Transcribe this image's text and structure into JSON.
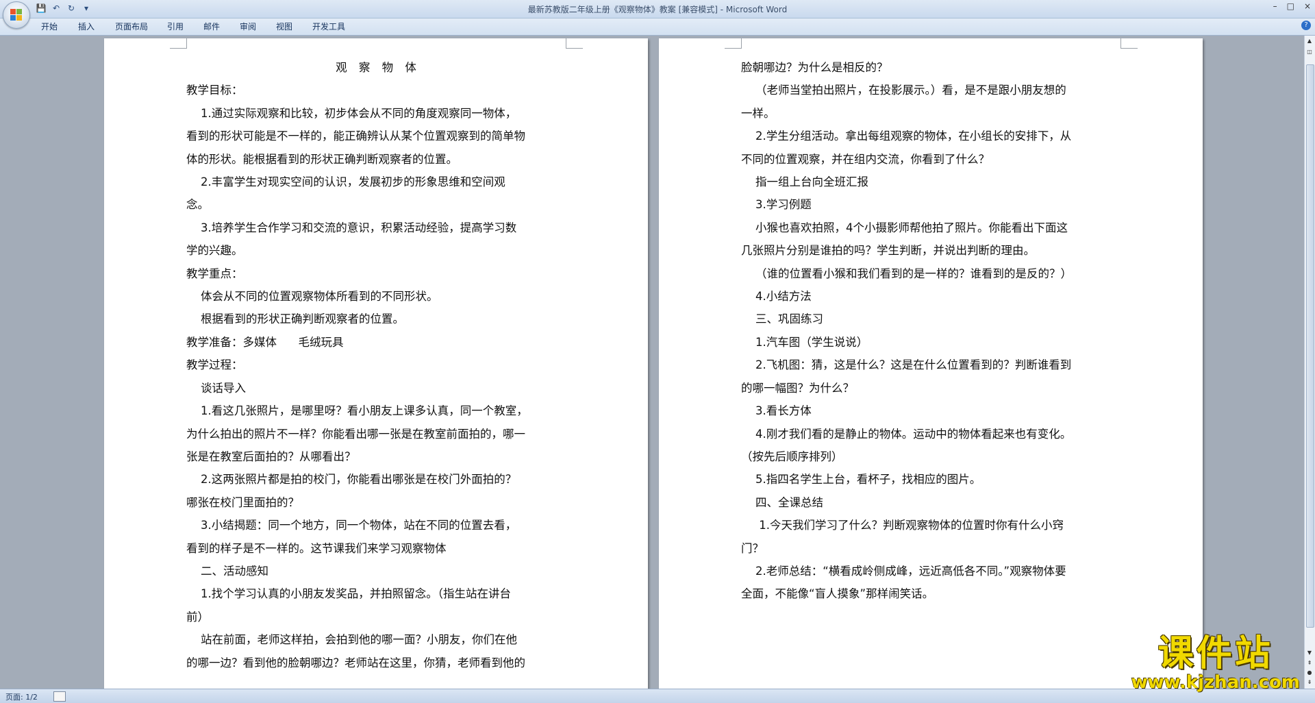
{
  "window": {
    "title": "最新苏教版二年级上册《观察物体》教案 [兼容模式] - Microsoft Word",
    "minimize": "–",
    "maximize": "□",
    "close": "×"
  },
  "quick_access": {
    "save": "💾",
    "undo": "↶",
    "redo": "↻",
    "customize": "▾"
  },
  "ribbon": {
    "tabs": [
      "开始",
      "插入",
      "页面布局",
      "引用",
      "邮件",
      "审阅",
      "视图",
      "开发工具"
    ],
    "help": "?"
  },
  "document": {
    "left_page": [
      {
        "text": "观 察 物 体",
        "style": "center"
      },
      {
        "text": "教学目标："
      },
      {
        "text": "    1.通过实际观察和比较，初步体会从不同的角度观察同一物体，"
      },
      {
        "text": "看到的形状可能是不一样的，能正确辨认从某个位置观察到的简单物"
      },
      {
        "text": "体的形状。能根据看到的形状正确判断观察者的位置。"
      },
      {
        "text": "    2.丰富学生对现实空间的认识，发展初步的形象思维和空间观"
      },
      {
        "text": "念。"
      },
      {
        "text": "    3.培养学生合作学习和交流的意识，积累活动经验，提高学习数"
      },
      {
        "text": "学的兴趣。"
      },
      {
        "text": "教学重点："
      },
      {
        "text": "    体会从不同的位置观察物体所看到的不同形状。"
      },
      {
        "text": "    根据看到的形状正确判断观察者的位置。"
      },
      {
        "text": "教学准备：多媒体      毛绒玩具"
      },
      {
        "text": "教学过程："
      },
      {
        "text": "    谈话导入"
      },
      {
        "text": "    1.看这几张照片，是哪里呀？看小朋友上课多认真，同一个教室，"
      },
      {
        "text": "为什么拍出的照片不一样？你能看出哪一张是在教室前面拍的，哪一"
      },
      {
        "text": "张是在教室后面拍的？从哪看出？"
      },
      {
        "text": "    2.这两张照片都是拍的校门，你能看出哪张是在校门外面拍的？"
      },
      {
        "text": "哪张在校门里面拍的？"
      },
      {
        "text": "    3.小结揭题：同一个地方，同一个物体，站在不同的位置去看，"
      },
      {
        "text": "看到的样子是不一样的。这节课我们来学习观察物体"
      },
      {
        "text": "    二、活动感知"
      },
      {
        "text": "    1.找个学习认真的小朋友发奖品，并拍照留念。（指生站在讲台"
      },
      {
        "text": "前）"
      },
      {
        "text": "    站在前面，老师这样拍，会拍到他的哪一面？小朋友，你们在他"
      },
      {
        "text": "的哪一边？看到他的脸朝哪边？老师站在这里，你猜，老师看到他的"
      }
    ],
    "right_page": [
      {
        "text": "脸朝哪边？为什么是相反的？"
      },
      {
        "text": "    （老师当堂拍出照片，在投影展示。）看，是不是跟小朋友想的"
      },
      {
        "text": "一样。"
      },
      {
        "text": "    2.学生分组活动。拿出每组观察的物体，在小组长的安排下，从"
      },
      {
        "text": "不同的位置观察，并在组内交流，你看到了什么？"
      },
      {
        "text": "    指一组上台向全班汇报"
      },
      {
        "text": "    3.学习例题"
      },
      {
        "text": "    小猴也喜欢拍照，4个小摄影师帮他拍了照片。你能看出下面这"
      },
      {
        "text": "几张照片分别是谁拍的吗？学生判断，并说出判断的理由。"
      },
      {
        "text": "    （谁的位置看小猴和我们看到的是一样的？谁看到的是反的？）"
      },
      {
        "text": "    4.小结方法"
      },
      {
        "text": "    三、巩固练习"
      },
      {
        "text": "    1.汽车图（学生说说）"
      },
      {
        "text": "    2.飞机图：猜，这是什么？这是在什么位置看到的？判断谁看到"
      },
      {
        "text": "的哪一幅图？为什么？"
      },
      {
        "text": "    3.看长方体"
      },
      {
        "text": "    4.刚才我们看的是静止的物体。运动中的物体看起来也有变化。"
      },
      {
        "text": "（按先后顺序排列）"
      },
      {
        "text": "    5.指四名学生上台，看杯子，找相应的图片。"
      },
      {
        "text": "    四、全课总结"
      },
      {
        "text": "     1.今天我们学习了什么？判断观察物体的位置时你有什么小窍"
      },
      {
        "text": "门？"
      },
      {
        "text": "    2.老师总结：“横看成岭侧成峰，远近高低各不同。”观察物体要"
      },
      {
        "text": "全面，不能像“盲人摸象”那样闹笑话。"
      },
      {
        "text": "    "
      },
      {
        "text": "    "
      }
    ]
  },
  "statusbar": {
    "page": "页面: 1/2"
  },
  "watermark": {
    "big": "课件站",
    "small": "www.kjzhan.com"
  }
}
